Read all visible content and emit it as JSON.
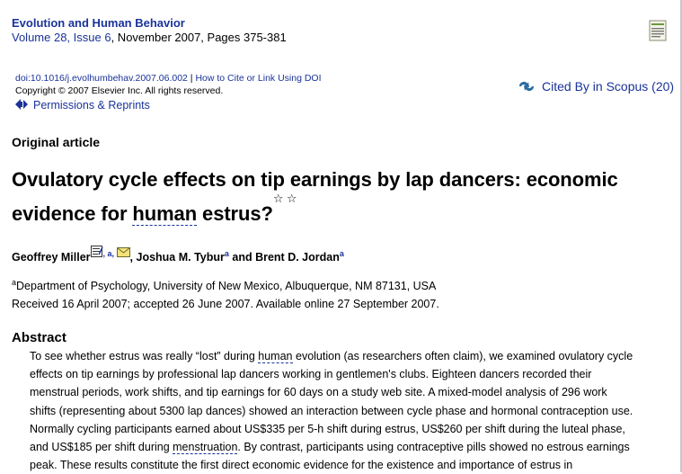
{
  "journal": {
    "title": "Evolution and Human Behavior",
    "volume_issue": "Volume 28, Issue 6",
    "date_pages": ", November 2007, Pages 375-381"
  },
  "doi": {
    "doi_link": "doi:10.1016/j.evolhumbehav.2007.06.002",
    "separator": " | ",
    "cite_link": "How to Cite or Link Using DOI"
  },
  "copyright": "Copyright © 2007 Elsevier Inc. All rights reserved.",
  "permissions": "Permissions & Reprints",
  "scopus": "Cited By in Scopus (20)",
  "article_type": "Original article",
  "title": {
    "line1": "Ovulatory cycle effects on tip earnings by lap dancers: economic",
    "line2_pre": "evidence for ",
    "line2_link": "human",
    "line2_post": " estrus?",
    "stars": "☆ ☆"
  },
  "authors": {
    "a1": "Geoffrey Miller",
    "a1_sup": ", a, ",
    "a2": ", Joshua M. Tybur",
    "a2_sup": "a",
    "a3": " and Brent D. Jordan",
    "a3_sup": "a"
  },
  "affiliation": {
    "sup": "a",
    "text": "Department of Psychology, University of New Mexico, Albuquerque, NM 87131, USA"
  },
  "received": "Received 16 April 2007;  accepted 26 June 2007.  Available online 27 September 2007.",
  "abstract": {
    "heading": "Abstract",
    "l1_pre": "To see whether estrus was really “lost” during ",
    "l1_link": "human",
    "l1_post": " evolution (as researchers often claim), we examined ovulatory cycle",
    "l2": "effects on tip earnings by professional lap dancers working in gentlemen's clubs. Eighteen dancers recorded their",
    "l3": "menstrual periods, work shifts, and tip earnings for 60 days on a study web site. A mixed-model analysis of 296 work",
    "l4": "shifts (representing about 5300 lap dances) showed an interaction between cycle phase and hormonal contraception use.",
    "l5": "Normally cycling participants earned about US$335 per 5-h shift during estrus, US$260 per shift during the luteal phase,",
    "l6_pre": "and US$185 per shift during ",
    "l6_link": "menstruation",
    "l6_post": ". By contrast, participants using contraceptive pills showed no estrous earnings",
    "l7": "peak. These results constitute the first direct economic evidence for the existence and importance of estrus in"
  },
  "colors": {
    "link": "#1a3399",
    "text": "#000000"
  }
}
